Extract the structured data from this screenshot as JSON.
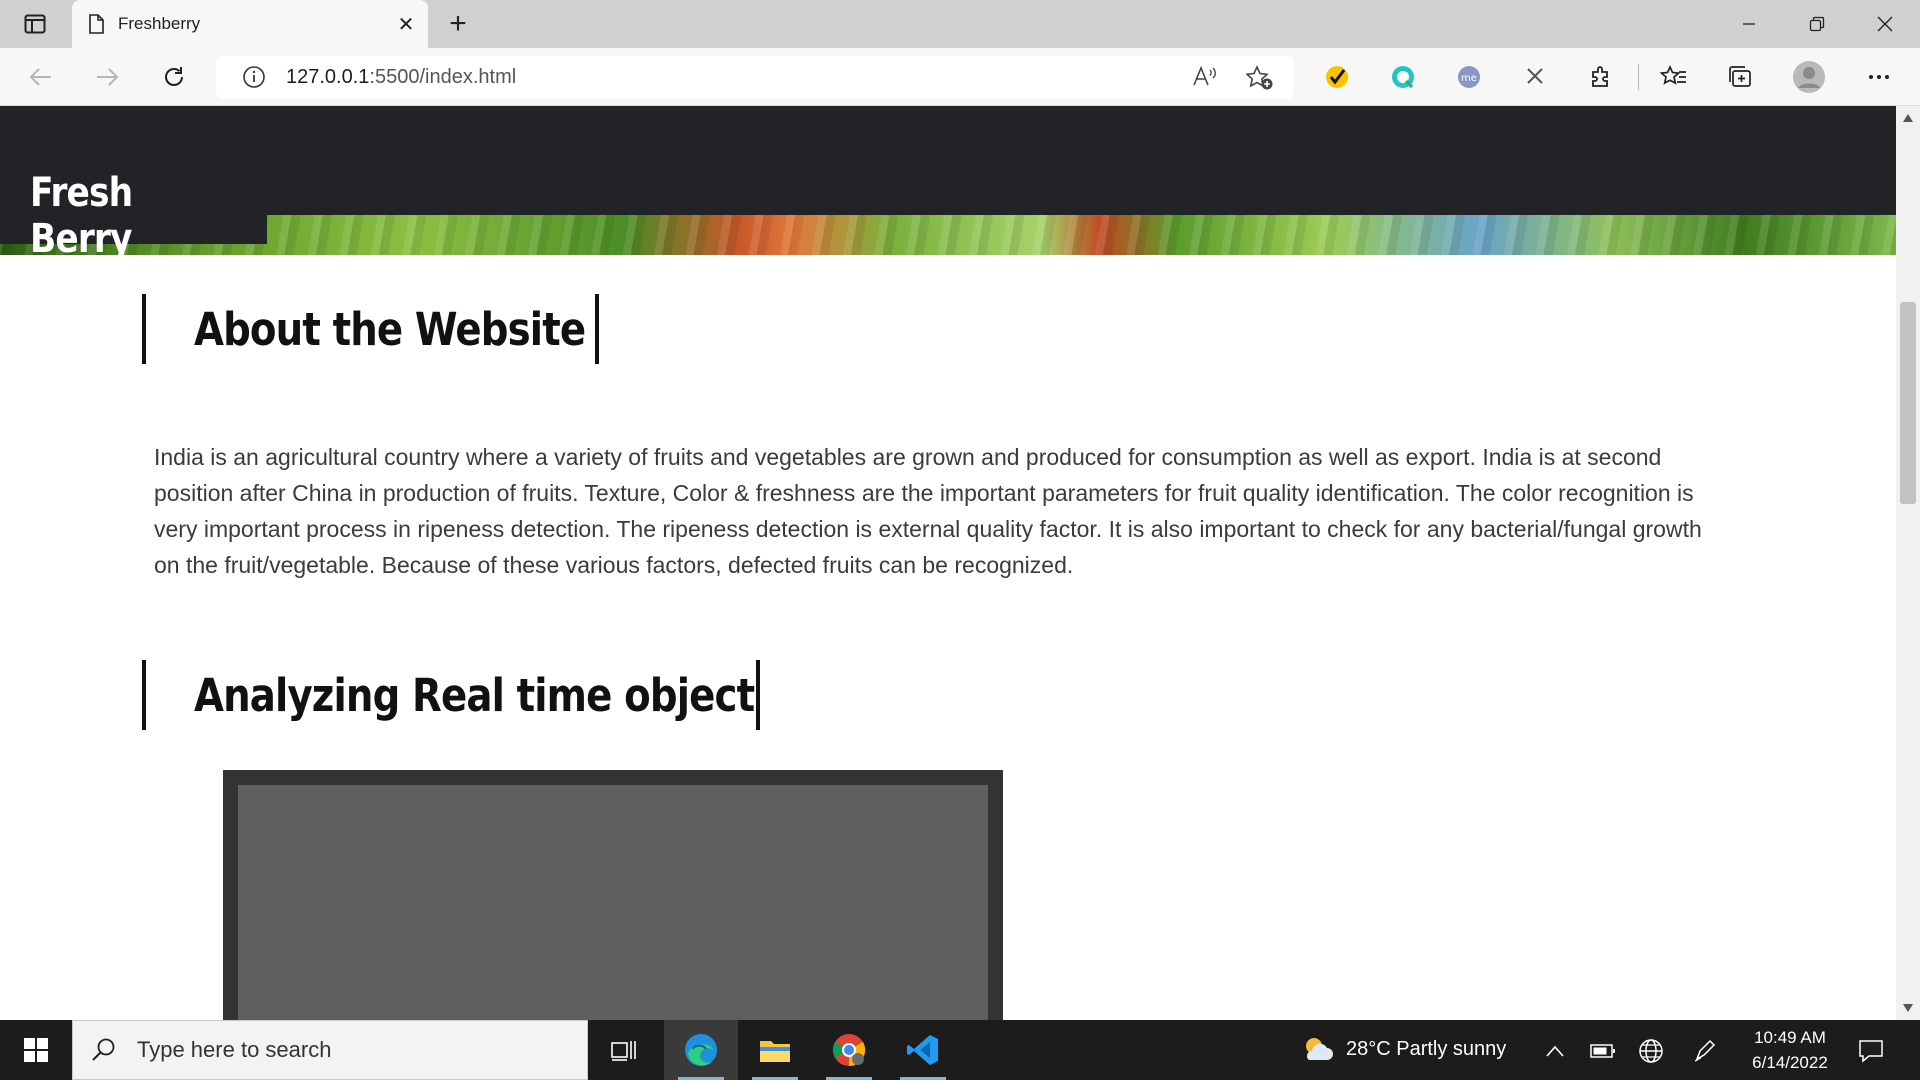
{
  "browser": {
    "tab_title": "Freshberry",
    "url_host": "127.0.0.1",
    "url_path": ":5500/index.html",
    "new_tab_symbol": "+",
    "close_symbol": "✕"
  },
  "site": {
    "brand": "Fresh Berry",
    "about_heading": "About the Website",
    "about_text": "India is an agricultural country where a variety of fruits and vegetables are grown and produced for consumption as well as export. India is at second position after China in production of fruits. Texture, Color & freshness are the important parameters for fruit quality identification. The color recognition is very important process in ripeness detection. The ripeness detection is external quality factor. It is also important to check for any bacterial/fungal growth on the fruit/vegetable. Because of these various factors, defected fruits can be recognized.",
    "analyze_heading": "Analyzing Real time object"
  },
  "taskbar": {
    "search_placeholder": "Type here to search",
    "weather": "28°C  Partly sunny",
    "time": "10:49 AM",
    "date": "6/14/2022"
  },
  "colors": {
    "header_bg": "#212327",
    "accent_taskbar": "#76b9ed"
  }
}
